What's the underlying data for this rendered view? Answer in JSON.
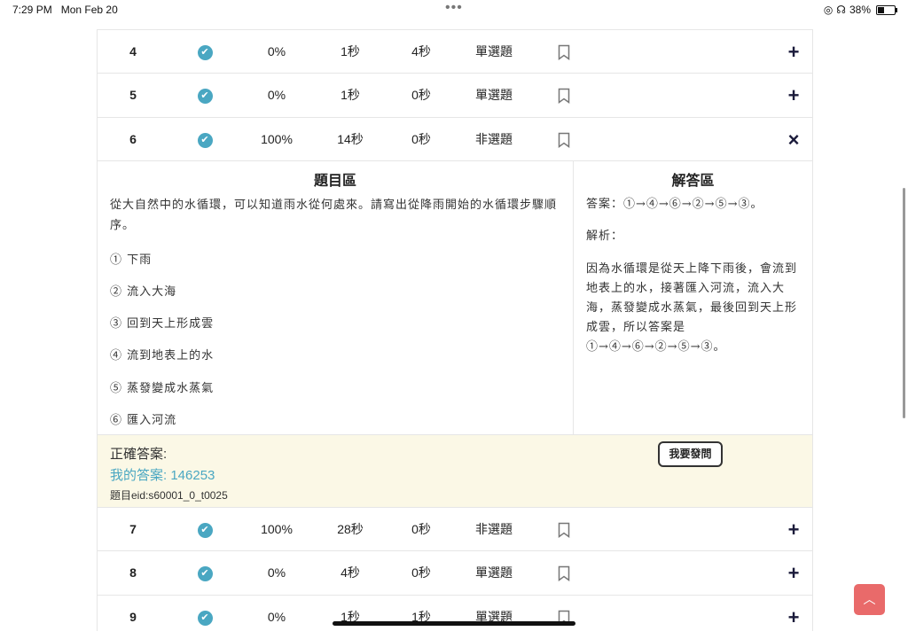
{
  "status": {
    "time": "7:29 PM",
    "date": "Mon Feb 20",
    "battery": "38%"
  },
  "rows_top": [
    {
      "num": "4",
      "pct": "0%",
      "t1": "1秒",
      "t2": "4秒",
      "type": "單選題",
      "action": "+"
    },
    {
      "num": "5",
      "pct": "0%",
      "t1": "1秒",
      "t2": "0秒",
      "type": "單選題",
      "action": "+"
    },
    {
      "num": "6",
      "pct": "100%",
      "t1": "14秒",
      "t2": "0秒",
      "type": "非選題",
      "action": "×"
    }
  ],
  "detail": {
    "question_title": "題目區",
    "answer_title": "解答區",
    "question_text": "從大自然中的水循環，可以知道雨水從何處來。請寫出從降雨開始的水循環步驟順序。",
    "options": [
      "① 下雨",
      "② 流入大海",
      "③ 回到天上形成雲",
      "④ 流到地表上的水",
      "⑤ 蒸發變成水蒸氣",
      "⑥ 匯入河流"
    ],
    "answer_line": "答案：①→④→⑥→②→⑤→③。",
    "analysis_label": "解析：",
    "analysis_text": "因為水循環是從天上降下雨後，會流到地表上的水，接著匯入河流，流入大海，蒸發變成水蒸氣，最後回到天上形成雲，所以答案是①→④→⑥→②→⑤→③。"
  },
  "answer_box": {
    "correct_label": "正確答案:",
    "my_answer": "我的答案: 146253",
    "eid": "題目eid:s60001_0_t0025",
    "ask_button": "我要發問"
  },
  "rows_bottom": [
    {
      "num": "7",
      "pct": "100%",
      "t1": "28秒",
      "t2": "0秒",
      "type": "非選題",
      "action": "+"
    },
    {
      "num": "8",
      "pct": "0%",
      "t1": "4秒",
      "t2": "0秒",
      "type": "單選題",
      "action": "+"
    },
    {
      "num": "9",
      "pct": "0%",
      "t1": "1秒",
      "t2": "1秒",
      "type": "單選題",
      "action": "+"
    }
  ],
  "scroll_top_icon": "chevron-up-icon",
  "colors": {
    "accent": "#4aa7c2",
    "highlight": "#fbf8e6",
    "to_top": "#e96a6a"
  }
}
